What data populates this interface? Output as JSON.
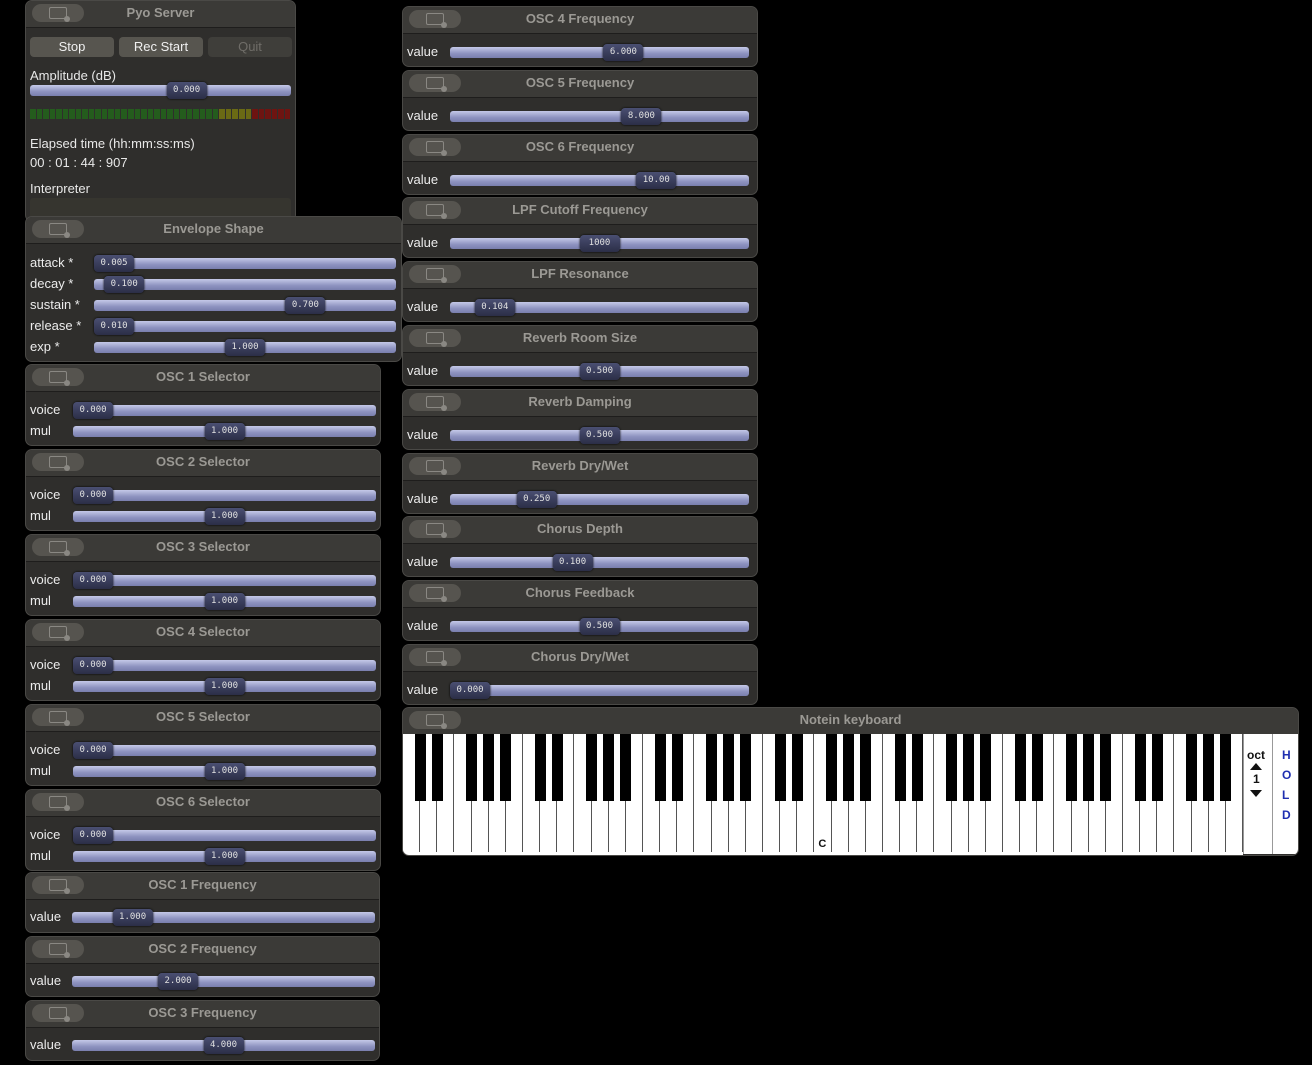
{
  "server": {
    "title": "Pyo Server",
    "stop_label": "Stop",
    "rec_label": "Rec Start",
    "quit_label": "Quit",
    "amp_label": "Amplitude (dB)",
    "amp_value": "0.000",
    "amp_level": 0.6,
    "elapsed_label": "Elapsed time (hh:mm:ss:ms)",
    "elapsed_value": "00 : 01 : 44 : 907",
    "interpreter_label": "Interpreter"
  },
  "envelope": {
    "title": "Envelope Shape",
    "params": [
      {
        "label": "attack *",
        "value": "0.005",
        "level": 0.005
      },
      {
        "label": "decay *",
        "value": "0.100",
        "level": 0.1
      },
      {
        "label": "sustain *",
        "value": "0.700",
        "level": 0.7
      },
      {
        "label": "release *",
        "value": "0.010",
        "level": 0.01
      },
      {
        "label": "exp *",
        "value": "1.000",
        "level": 0.5
      }
    ]
  },
  "selectors": [
    {
      "title": "OSC 1 Selector",
      "voice": "0.000",
      "mul": "1.000"
    },
    {
      "title": "OSC 2 Selector",
      "voice": "0.000",
      "mul": "1.000"
    },
    {
      "title": "OSC 3 Selector",
      "voice": "0.000",
      "mul": "1.000"
    },
    {
      "title": "OSC 4 Selector",
      "voice": "0.000",
      "mul": "1.000"
    },
    {
      "title": "OSC 5 Selector",
      "voice": "0.000",
      "mul": "1.000"
    },
    {
      "title": "OSC 6 Selector",
      "voice": "0.000",
      "mul": "1.000"
    }
  ],
  "selector_labels": {
    "voice": "voice",
    "mul": "mul"
  },
  "left_controls": [
    {
      "title": "OSC 1 Frequency",
      "label": "value",
      "value": "1.000",
      "level": 0.2
    },
    {
      "title": "OSC 2 Frequency",
      "label": "value",
      "value": "2.000",
      "level": 0.35
    },
    {
      "title": "OSC 3 Frequency",
      "label": "value",
      "value": "4.000",
      "level": 0.5
    }
  ],
  "right_controls": [
    {
      "title": "OSC 4 Frequency",
      "label": "value",
      "value": "6.000",
      "level": 0.58
    },
    {
      "title": "OSC 5 Frequency",
      "label": "value",
      "value": "8.000",
      "level": 0.64
    },
    {
      "title": "OSC 6 Frequency",
      "label": "value",
      "value": "10.00",
      "level": 0.69
    },
    {
      "title": "LPF Cutoff Frequency",
      "label": "value",
      "value": "1000",
      "level": 0.5
    },
    {
      "title": "LPF Resonance",
      "label": "value",
      "value": "0.104",
      "level": 0.15
    },
    {
      "title": "Reverb Room Size",
      "label": "value",
      "value": "0.500",
      "level": 0.5
    },
    {
      "title": "Reverb Damping",
      "label": "value",
      "value": "0.500",
      "level": 0.5
    },
    {
      "title": "Reverb Dry/Wet",
      "label": "value",
      "value": "0.250",
      "level": 0.29
    },
    {
      "title": "Chorus Depth",
      "label": "value",
      "value": "0.100",
      "level": 0.41
    },
    {
      "title": "Chorus Feedback",
      "label": "value",
      "value": "0.500",
      "level": 0.5
    },
    {
      "title": "Chorus Dry/Wet",
      "label": "value",
      "value": "0.000",
      "level": 0.06
    }
  ],
  "keyboard": {
    "title": "Notein keyboard",
    "middle_c_label": "C",
    "oct_label": "oct",
    "oct_value": "1",
    "hold_letters": [
      "H",
      "O",
      "L",
      "D"
    ],
    "hold_color": "#1f2fb0"
  }
}
